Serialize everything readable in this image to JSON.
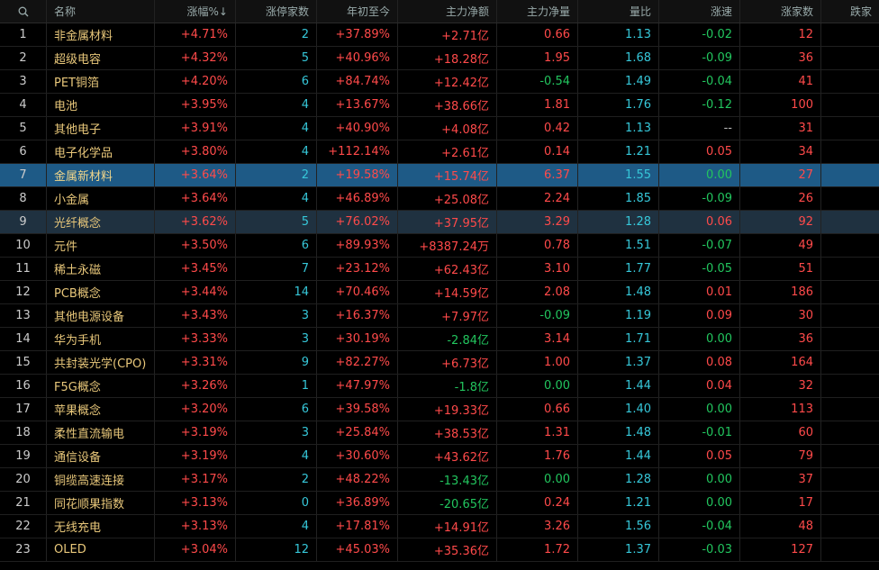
{
  "headers": [
    "名称",
    "涨幅%↓",
    "涨停家数",
    "年初至今",
    "主力净额",
    "主力净量",
    "量比",
    "涨速",
    "涨家数",
    "跌家"
  ],
  "rows": [
    {
      "no": "1",
      "name": "非金属材料",
      "chg": "+4.71%",
      "limit": "2",
      "ytd": "+37.89%",
      "net": "+2.71亿",
      "vol": "0.66",
      "ratio": "1.13",
      "speed": "-0.02",
      "up": "12"
    },
    {
      "no": "2",
      "name": "超级电容",
      "chg": "+4.32%",
      "limit": "5",
      "ytd": "+40.96%",
      "net": "+18.28亿",
      "vol": "1.95",
      "ratio": "1.68",
      "speed": "-0.09",
      "up": "36"
    },
    {
      "no": "3",
      "name": "PET铜箔",
      "chg": "+4.20%",
      "limit": "6",
      "ytd": "+84.74%",
      "net": "+12.42亿",
      "vol": "-0.54",
      "ratio": "1.49",
      "speed": "-0.04",
      "up": "41"
    },
    {
      "no": "4",
      "name": "电池",
      "chg": "+3.95%",
      "limit": "4",
      "ytd": "+13.67%",
      "net": "+38.66亿",
      "vol": "1.81",
      "ratio": "1.76",
      "speed": "-0.12",
      "up": "100"
    },
    {
      "no": "5",
      "name": "其他电子",
      "chg": "+3.91%",
      "limit": "4",
      "ytd": "+40.90%",
      "net": "+4.08亿",
      "vol": "0.42",
      "ratio": "1.13",
      "speed": "--",
      "up": "31"
    },
    {
      "no": "6",
      "name": "电子化学品",
      "chg": "+3.80%",
      "limit": "4",
      "ytd": "+112.14%",
      "net": "+2.61亿",
      "vol": "0.14",
      "ratio": "1.21",
      "speed": "0.05",
      "up": "34"
    },
    {
      "no": "7",
      "name": "金属新材料",
      "chg": "+3.64%",
      "limit": "2",
      "ytd": "+19.58%",
      "net": "+15.74亿",
      "vol": "6.37",
      "ratio": "1.55",
      "speed": "0.00",
      "up": "27"
    },
    {
      "no": "8",
      "name": "小金属",
      "chg": "+3.64%",
      "limit": "4",
      "ytd": "+46.89%",
      "net": "+25.08亿",
      "vol": "2.24",
      "ratio": "1.85",
      "speed": "-0.09",
      "up": "26"
    },
    {
      "no": "9",
      "name": "光纤概念",
      "chg": "+3.62%",
      "limit": "5",
      "ytd": "+76.02%",
      "net": "+37.95亿",
      "vol": "3.29",
      "ratio": "1.28",
      "speed": "0.06",
      "up": "92"
    },
    {
      "no": "10",
      "name": "元件",
      "chg": "+3.50%",
      "limit": "6",
      "ytd": "+89.93%",
      "net": "+8387.24万",
      "vol": "0.78",
      "ratio": "1.51",
      "speed": "-0.07",
      "up": "49"
    },
    {
      "no": "11",
      "name": "稀土永磁",
      "chg": "+3.45%",
      "limit": "7",
      "ytd": "+23.12%",
      "net": "+62.43亿",
      "vol": "3.10",
      "ratio": "1.77",
      "speed": "-0.05",
      "up": "51"
    },
    {
      "no": "12",
      "name": "PCB概念",
      "chg": "+3.44%",
      "limit": "14",
      "ytd": "+70.46%",
      "net": "+14.59亿",
      "vol": "2.08",
      "ratio": "1.48",
      "speed": "0.01",
      "up": "186"
    },
    {
      "no": "13",
      "name": "其他电源设备",
      "chg": "+3.43%",
      "limit": "3",
      "ytd": "+16.37%",
      "net": "+7.97亿",
      "vol": "-0.09",
      "ratio": "1.19",
      "speed": "0.09",
      "up": "30"
    },
    {
      "no": "14",
      "name": "华为手机",
      "chg": "+3.33%",
      "limit": "3",
      "ytd": "+30.19%",
      "net": "-2.84亿",
      "vol": "3.14",
      "ratio": "1.71",
      "speed": "0.00",
      "up": "36"
    },
    {
      "no": "15",
      "name": "共封装光学(CPO)",
      "chg": "+3.31%",
      "limit": "9",
      "ytd": "+82.27%",
      "net": "+6.73亿",
      "vol": "1.00",
      "ratio": "1.37",
      "speed": "0.08",
      "up": "164"
    },
    {
      "no": "16",
      "name": "F5G概念",
      "chg": "+3.26%",
      "limit": "1",
      "ytd": "+47.97%",
      "net": "-1.8亿",
      "vol": "0.00",
      "ratio": "1.44",
      "speed": "0.04",
      "up": "32"
    },
    {
      "no": "17",
      "name": "苹果概念",
      "chg": "+3.20%",
      "limit": "6",
      "ytd": "+39.58%",
      "net": "+19.33亿",
      "vol": "0.66",
      "ratio": "1.40",
      "speed": "0.00",
      "up": "113"
    },
    {
      "no": "18",
      "name": "柔性直流输电",
      "chg": "+3.19%",
      "limit": "3",
      "ytd": "+25.84%",
      "net": "+38.53亿",
      "vol": "1.31",
      "ratio": "1.48",
      "speed": "-0.01",
      "up": "60"
    },
    {
      "no": "19",
      "name": "通信设备",
      "chg": "+3.19%",
      "limit": "4",
      "ytd": "+30.60%",
      "net": "+43.62亿",
      "vol": "1.76",
      "ratio": "1.44",
      "speed": "0.05",
      "up": "79"
    },
    {
      "no": "20",
      "name": "铜缆高速连接",
      "chg": "+3.17%",
      "limit": "2",
      "ytd": "+48.22%",
      "net": "-13.43亿",
      "vol": "0.00",
      "ratio": "1.28",
      "speed": "0.00",
      "up": "37"
    },
    {
      "no": "21",
      "name": "同花顺果指数",
      "chg": "+3.13%",
      "limit": "0",
      "ytd": "+36.89%",
      "net": "-20.65亿",
      "vol": "0.24",
      "ratio": "1.21",
      "speed": "0.00",
      "up": "17"
    },
    {
      "no": "22",
      "name": "无线充电",
      "chg": "+3.13%",
      "limit": "4",
      "ytd": "+17.81%",
      "net": "+14.91亿",
      "vol": "3.26",
      "ratio": "1.56",
      "speed": "-0.04",
      "up": "48"
    },
    {
      "no": "23",
      "name": "OLED",
      "chg": "+3.04%",
      "limit": "12",
      "ytd": "+45.03%",
      "net": "+35.36亿",
      "vol": "1.72",
      "ratio": "1.37",
      "speed": "-0.03",
      "up": "127"
    }
  ],
  "selected_row": "7",
  "hover_row": "9",
  "colors": {
    "up": "#ff4a4a",
    "down": "#22c55e",
    "neutral": "#bbbbbb",
    "name": "#e8c77a",
    "cyan": "#36c7d9",
    "selected": "#1e5a86"
  }
}
